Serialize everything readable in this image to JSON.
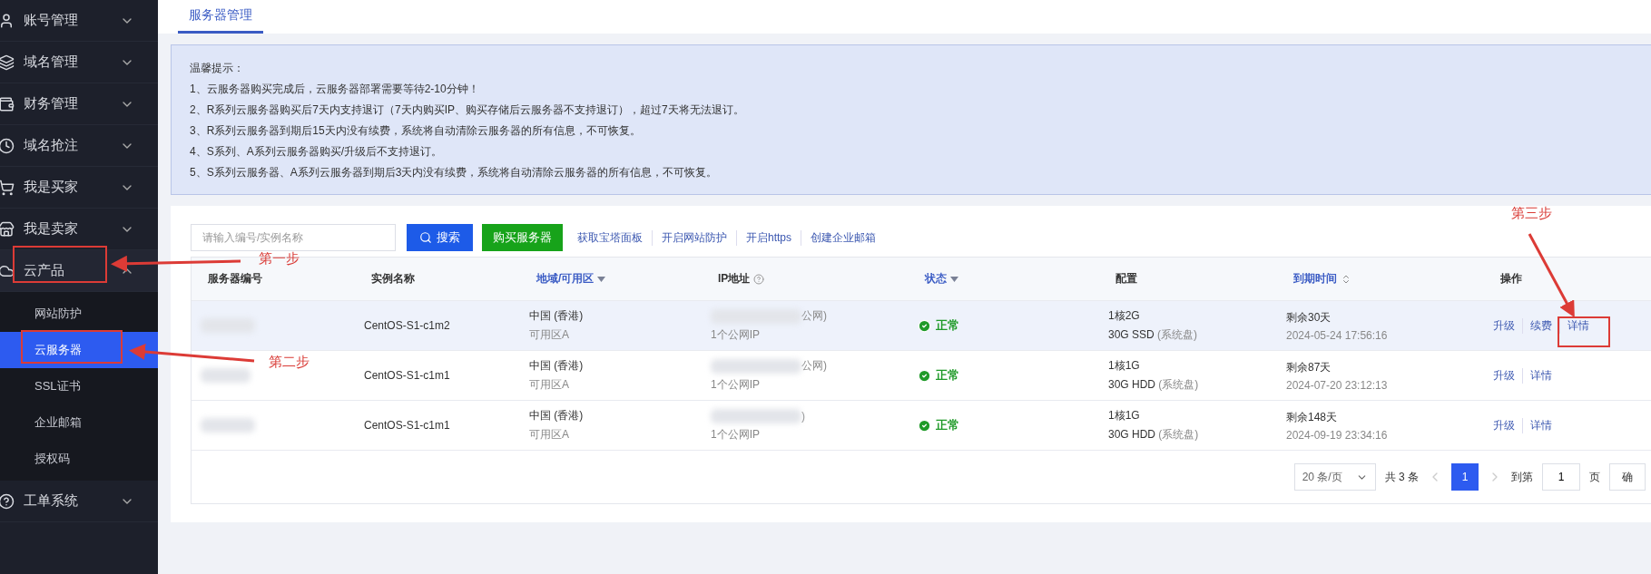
{
  "sidebar": {
    "items": [
      {
        "label": "账号管理",
        "expanded": false
      },
      {
        "label": "域名管理",
        "expanded": false
      },
      {
        "label": "财务管理",
        "expanded": false
      },
      {
        "label": "域名抢注",
        "expanded": false
      },
      {
        "label": "我是买家",
        "expanded": false
      },
      {
        "label": "我是卖家",
        "expanded": false
      },
      {
        "label": "云产品",
        "expanded": true,
        "children": [
          {
            "label": "网站防护",
            "selected": false
          },
          {
            "label": "云服务器",
            "selected": true
          },
          {
            "label": "SSL证书",
            "selected": false
          },
          {
            "label": "企业邮箱",
            "selected": false
          },
          {
            "label": "授权码",
            "selected": false
          }
        ]
      },
      {
        "label": "工单系统",
        "expanded": false
      }
    ]
  },
  "tabs": [
    {
      "label": "服务器管理",
      "selected": true
    }
  ],
  "notice": {
    "title": "温馨提示：",
    "lines": [
      "1、云服务器购买完成后，云服务器部署需要等待2-10分钟！",
      "2、R系列云服务器购买后7天内支持退订（7天内购买IP、购买存储后云服务器不支持退订），超过7天将无法退订。",
      "3、R系列云服务器到期后15天内没有续费，系统将自动清除云服务器的所有信息，不可恢复。",
      "4、S系列、A系列云服务器购买/升级后不支持退订。",
      "5、S系列云服务器、A系列云服务器到期后3天内没有续费，系统将自动清除云服务器的所有信息，不可恢复。"
    ]
  },
  "toolbar": {
    "search": {
      "placeholder": "请输入编号/实例名称"
    },
    "search_button": "搜索",
    "buy_button": "购买服务器",
    "links": [
      "获取宝塔面板",
      "开启网站防护",
      "开启https",
      "创建企业邮箱"
    ]
  },
  "table": {
    "columns": [
      {
        "label": "服务器编号",
        "kind": "plain"
      },
      {
        "label": "实例名称",
        "kind": "plain"
      },
      {
        "label": "地域/可用区",
        "kind": "filter"
      },
      {
        "label": "IP地址",
        "kind": "help"
      },
      {
        "label": "状态",
        "kind": "filter"
      },
      {
        "label": "配置",
        "kind": "plain"
      },
      {
        "label": "到期时间",
        "kind": "sort"
      },
      {
        "label": "操作",
        "kind": "plain"
      }
    ],
    "rows": [
      {
        "highlighted": true,
        "name": "CentOS-S1-c1m2",
        "region": "中国 (香港)",
        "zone": "可用区A",
        "ip_tail": "公网)",
        "ip_count": "1个公网IP",
        "status": "正常",
        "kind": "ok",
        "cpu_mem": "1核2G",
        "disk": "30G SSD",
        "disk_note": "(系统盘)",
        "remaining": "剩余30天",
        "expires": "2024-05-24 17:56:16",
        "actions": [
          "升级",
          "续费",
          "详情"
        ]
      },
      {
        "highlighted": false,
        "name": "CentOS-S1-c1m1",
        "region": "中国 (香港)",
        "zone": "可用区A",
        "ip_tail": "公网)",
        "ip_count": "1个公网IP",
        "status": "正常",
        "kind": "ok",
        "cpu_mem": "1核1G",
        "disk": "30G HDD",
        "disk_note": "(系统盘)",
        "remaining": "剩余87天",
        "expires": "2024-07-20 23:12:13",
        "actions": [
          "升级",
          "详情"
        ]
      },
      {
        "highlighted": false,
        "name": "CentOS-S1-c1m1",
        "region": "中国 (香港)",
        "zone": "可用区A",
        "ip_tail": ")",
        "ip_count": "1个公网IP",
        "status": "正常",
        "kind": "ok",
        "cpu_mem": "1核1G",
        "disk": "30G HDD",
        "disk_note": "(系统盘)",
        "remaining": "剩余148天",
        "expires": "2024-09-19 23:34:16",
        "actions": [
          "升级",
          "详情"
        ]
      }
    ]
  },
  "pagination": {
    "page_size": "20 条/页",
    "total": "共 3 条",
    "pages": [
      {
        "label": "1",
        "selected": true
      }
    ],
    "goto_label": "到第",
    "goto_value": "1",
    "page_unit": "页",
    "confirm": "确"
  },
  "annotations": [
    {
      "label": "第一步"
    },
    {
      "label": "第二步"
    },
    {
      "label": "第三步"
    }
  ]
}
